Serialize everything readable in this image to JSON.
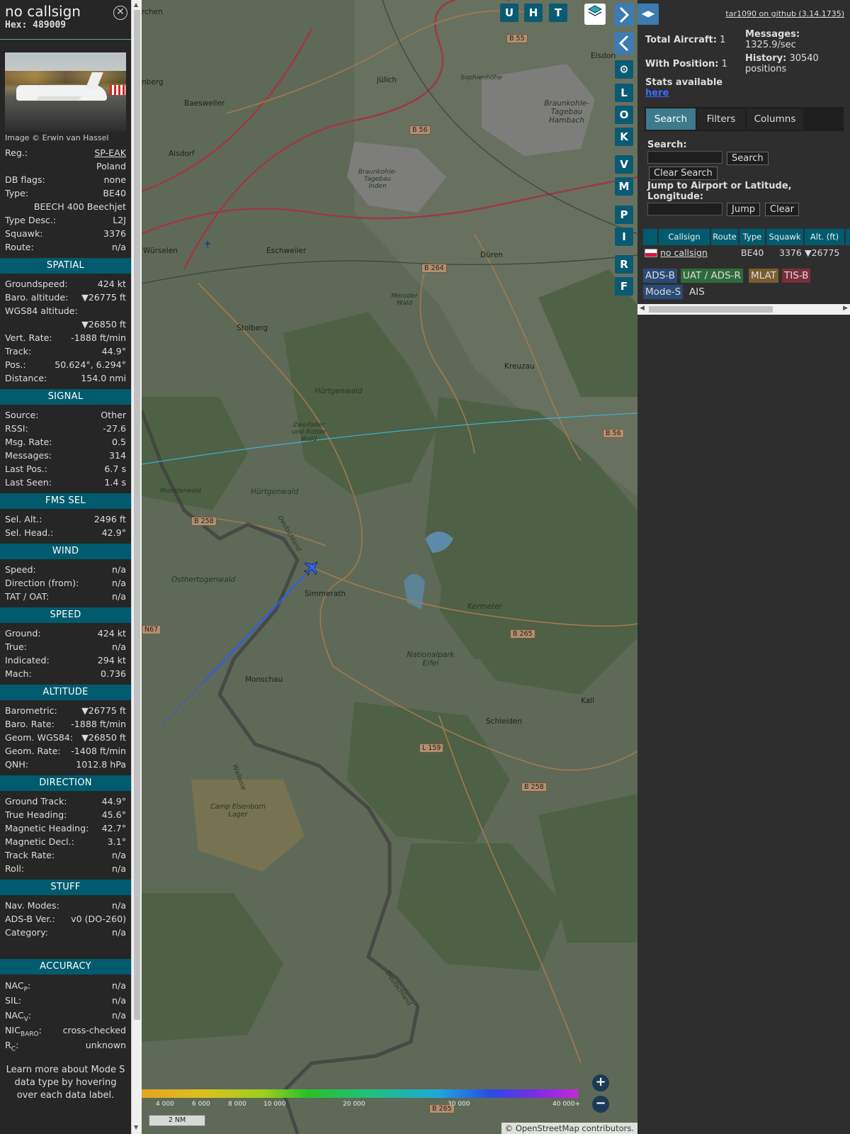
{
  "info": {
    "callsign": "no callsign",
    "hex": "Hex: 489009",
    "image_credit": "Image © Erwin van Hassel",
    "rows_top": [
      {
        "k": "Reg.:",
        "v": "SP-EAK",
        "link": true
      },
      {
        "k": "",
        "v": "Poland"
      },
      {
        "k": "DB flags:",
        "v": "none"
      },
      {
        "k": "Type:",
        "v": "BE40"
      },
      {
        "k": "",
        "v": "BEECH 400 Beechjet"
      },
      {
        "k": "Type Desc.:",
        "v": "L2J"
      },
      {
        "k": "Squawk:",
        "v": "3376"
      },
      {
        "k": "Route:",
        "v": "n/a"
      }
    ],
    "spatial_title": "SPATIAL",
    "spatial": [
      {
        "k": "Groundspeed:",
        "v": "424 kt"
      },
      {
        "k": "Baro. altitude:",
        "v": "▼26775 ft"
      },
      {
        "k": "WGS84 altitude:",
        "v": ""
      },
      {
        "k": "",
        "v": "▼26850 ft"
      },
      {
        "k": "Vert. Rate:",
        "v": "-1888 ft/min"
      },
      {
        "k": "Track:",
        "v": "44.9°"
      },
      {
        "k": "Pos.:",
        "v": "50.624°, 6.294°"
      },
      {
        "k": "Distance:",
        "v": "154.0 nmi"
      }
    ],
    "signal_title": "SIGNAL",
    "signal": [
      {
        "k": "Source:",
        "v": "Other"
      },
      {
        "k": "RSSI:",
        "v": "-27.6"
      },
      {
        "k": "Msg. Rate:",
        "v": "0.5"
      },
      {
        "k": "Messages:",
        "v": "314"
      },
      {
        "k": "Last Pos.:",
        "v": "6.7 s"
      },
      {
        "k": "Last Seen:",
        "v": "1.4 s"
      }
    ],
    "fms_title": "FMS SEL",
    "fms": [
      {
        "k": "Sel. Alt.:",
        "v": "2496 ft"
      },
      {
        "k": "Sel. Head.:",
        "v": "42.9°"
      }
    ],
    "wind_title": "WIND",
    "wind": [
      {
        "k": "Speed:",
        "v": "n/a"
      },
      {
        "k": "Direction (from):",
        "v": "n/a"
      },
      {
        "k": "TAT / OAT:",
        "v": "n/a"
      }
    ],
    "speed_title": "SPEED",
    "speed": [
      {
        "k": "Ground:",
        "v": "424 kt"
      },
      {
        "k": "True:",
        "v": "n/a"
      },
      {
        "k": "Indicated:",
        "v": "294 kt"
      },
      {
        "k": "Mach:",
        "v": "0.736"
      }
    ],
    "altitude_title": "ALTITUDE",
    "altitude": [
      {
        "k": "Barometric:",
        "v": "▼26775 ft"
      },
      {
        "k": "Baro. Rate:",
        "v": "-1888 ft/min"
      },
      {
        "k": "Geom. WGS84:",
        "v": "▼26850 ft"
      },
      {
        "k": "Geom. Rate:",
        "v": "-1408 ft/min"
      },
      {
        "k": "QNH:",
        "v": "1012.8 hPa"
      }
    ],
    "direction_title": "DIRECTION",
    "direction": [
      {
        "k": "Ground Track:",
        "v": "44.9°"
      },
      {
        "k": "True Heading:",
        "v": "45.6°"
      },
      {
        "k": "Magnetic Heading:",
        "v": "42.7°"
      },
      {
        "k": "Magnetic Decl.:",
        "v": "3.1°"
      },
      {
        "k": "Track Rate:",
        "v": "n/a"
      },
      {
        "k": "Roll:",
        "v": "n/a"
      }
    ],
    "stuff_title": "STUFF",
    "stuff": [
      {
        "k": "Nav. Modes:",
        "v": "n/a"
      },
      {
        "k": "ADS-B Ver.:",
        "v": "v0 (DO-260)"
      },
      {
        "k": "Category:",
        "v": "n/a"
      }
    ],
    "accuracy_title": "ACCURACY",
    "accuracy": {
      "nacp_k": "NAC",
      "nacp_sub": "P",
      "nacp_v": "n/a",
      "sil_k": "SIL:",
      "sil_v": "n/a",
      "nacv_k": "NAC",
      "nacv_sub": "V",
      "nacv_v": "n/a",
      "nic_k": "NIC",
      "nic_sub": "BARO",
      "nic_v": "cross-checked",
      "rc_k": "R",
      "rc_sub": "C",
      "rc_v": "unknown"
    },
    "footer": "Learn more about Mode S data type by hovering over each data label."
  },
  "map": {
    "top_buttons": [
      "U",
      "H",
      "T"
    ],
    "side_buttons": [
      "L",
      "O",
      "K",
      "V",
      "M",
      "P",
      "I",
      "R",
      "F"
    ],
    "places": [
      "Jülich",
      "Baesweiler",
      "Alsdorf",
      "Eschweiler",
      "Würselen",
      "Stolberg",
      "Düren",
      "Kreuzau",
      "Simmerath",
      "Monschau",
      "Schleiden",
      "Kall",
      "Kermeter",
      "Hürtgenwald",
      "Hürtgenwald",
      "Osthertogenwald",
      "Munsterwald",
      "Nationalpark Eifel",
      "Camp Elsenborn Lager",
      "Braunkohle-Tagebau Hambach",
      "Braunkohle-Tagebau Inden",
      "Meroder Wald",
      "Zweifaller und Rotter Wald",
      "Sophienhöhe",
      "Elsdorf",
      "rchen",
      "nberg",
      "Deutschland",
      "Wallonie"
    ],
    "roads": [
      "B 55",
      "B 56",
      "B 264",
      "B 258",
      "B 265",
      "B 56",
      "L 159",
      "B 258",
      "B 265",
      "N67"
    ],
    "alt_ticks": [
      "4 000",
      "6 000",
      "8 000",
      "10 000",
      "20 000",
      "30 000",
      "40 000+"
    ],
    "scale": "2 NM",
    "attribution": "© OpenStreetMap contributors."
  },
  "right": {
    "github": "tar1090 on github (3.14.1735)",
    "total_label": "Total Aircraft:",
    "total_value": "1",
    "withpos_label": "With Position:",
    "withpos_value": "1",
    "messages_label": "Messages:",
    "messages_value": "1325.9/sec",
    "history_label": "History:",
    "history_value": "30540 positions",
    "stats_label": "Stats available",
    "stats_link": "here",
    "tabs": [
      "Search",
      "Filters",
      "Columns"
    ],
    "search_label": "Search:",
    "search_button": "Search",
    "clear_search": "Clear Search",
    "jump_label": "Jump to Airport or Latitude, Longitude:",
    "jump_button": "Jump",
    "clear_button": "Clear",
    "table_headers": [
      "Callsign",
      "Route",
      "Type",
      "Squawk",
      "Alt. (ft)"
    ],
    "table_row": {
      "callsign": "no callsign",
      "route": "",
      "type": "BE40",
      "squawk": "3376",
      "alt": "▼26775"
    },
    "sources": [
      "ADS-B",
      "UAT / ADS-R",
      "MLAT",
      "TIS-B",
      "Mode-S",
      "AIS"
    ]
  },
  "colors": {
    "section_bg": "#005b6e",
    "adsb": "#2a4a77",
    "uat": "#2d6b3a",
    "mlat": "#7a5c2d",
    "tisb": "#7a2d3a",
    "modes": "#2a4a77",
    "track": "#2451ff"
  }
}
